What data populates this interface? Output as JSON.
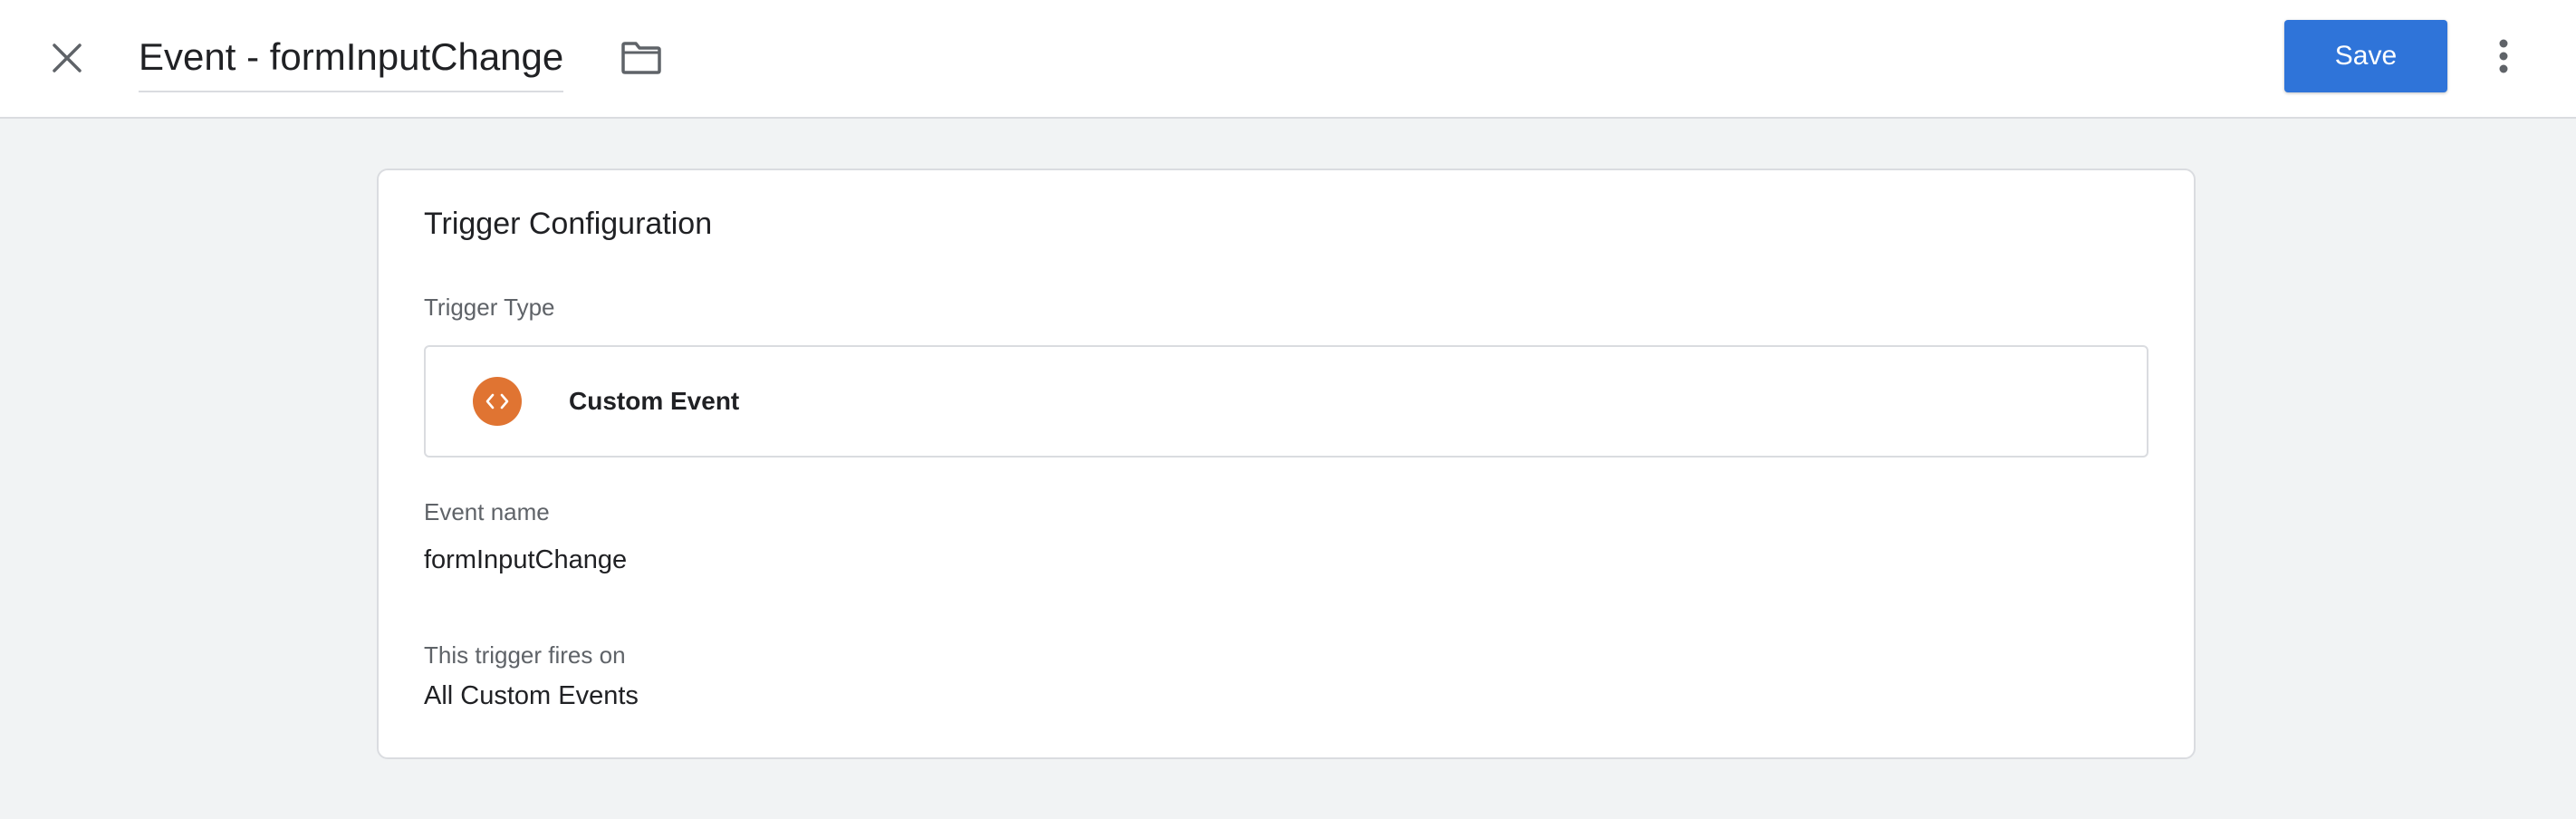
{
  "header": {
    "title": "Event - formInputChange",
    "save_label": "Save"
  },
  "card": {
    "title": "Trigger Configuration",
    "trigger_type_label": "Trigger Type",
    "trigger_type": {
      "name": "Custom Event",
      "icon": "code-brackets-icon",
      "icon_color": "#e07432"
    },
    "event_name_label": "Event name",
    "event_name_value": "formInputChange",
    "fires_on_label": "This trigger fires on",
    "fires_on_value": "All Custom Events"
  },
  "colors": {
    "accent": "#2f74d9",
    "background": "#f1f3f4"
  }
}
